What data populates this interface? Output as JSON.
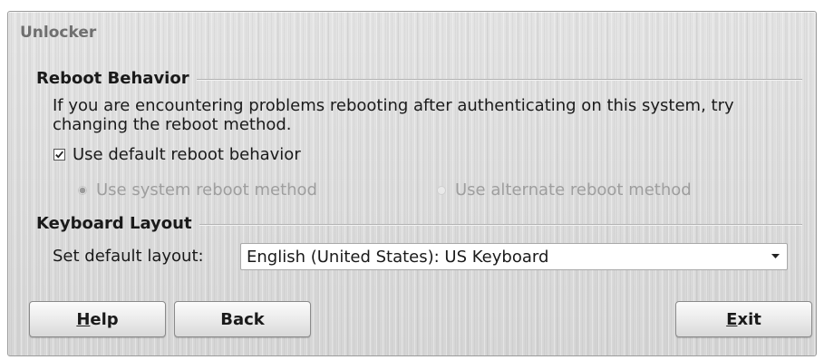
{
  "window": {
    "title": "Unlocker"
  },
  "reboot_section": {
    "heading": "Reboot Behavior",
    "description": "If you are encountering problems rebooting after authenticating on this system, try changing the reboot method.",
    "default_checkbox": {
      "label": "Use default reboot behavior",
      "checked": true
    },
    "options": [
      {
        "label": "Use system reboot method",
        "selected": true,
        "enabled": false
      },
      {
        "label": "Use alternate reboot method",
        "selected": false,
        "enabled": false
      }
    ]
  },
  "keyboard_section": {
    "heading": "Keyboard Layout",
    "field_label": "Set default layout:",
    "selected_layout": "English (United States): US Keyboard"
  },
  "buttons": {
    "help": {
      "mnemonic": "H",
      "rest": "elp"
    },
    "back": {
      "label": "Back"
    },
    "exit": {
      "mnemonic": "E",
      "rest": "xit"
    }
  },
  "icons": {
    "checkbox": "checkmark-icon",
    "dropdown": "chevron-down-icon"
  },
  "colors": {
    "panel_bg": "#dedede",
    "title_text": "#6f6f6f",
    "disabled_text": "#9e9e9e",
    "text": "#1a1a1a"
  }
}
